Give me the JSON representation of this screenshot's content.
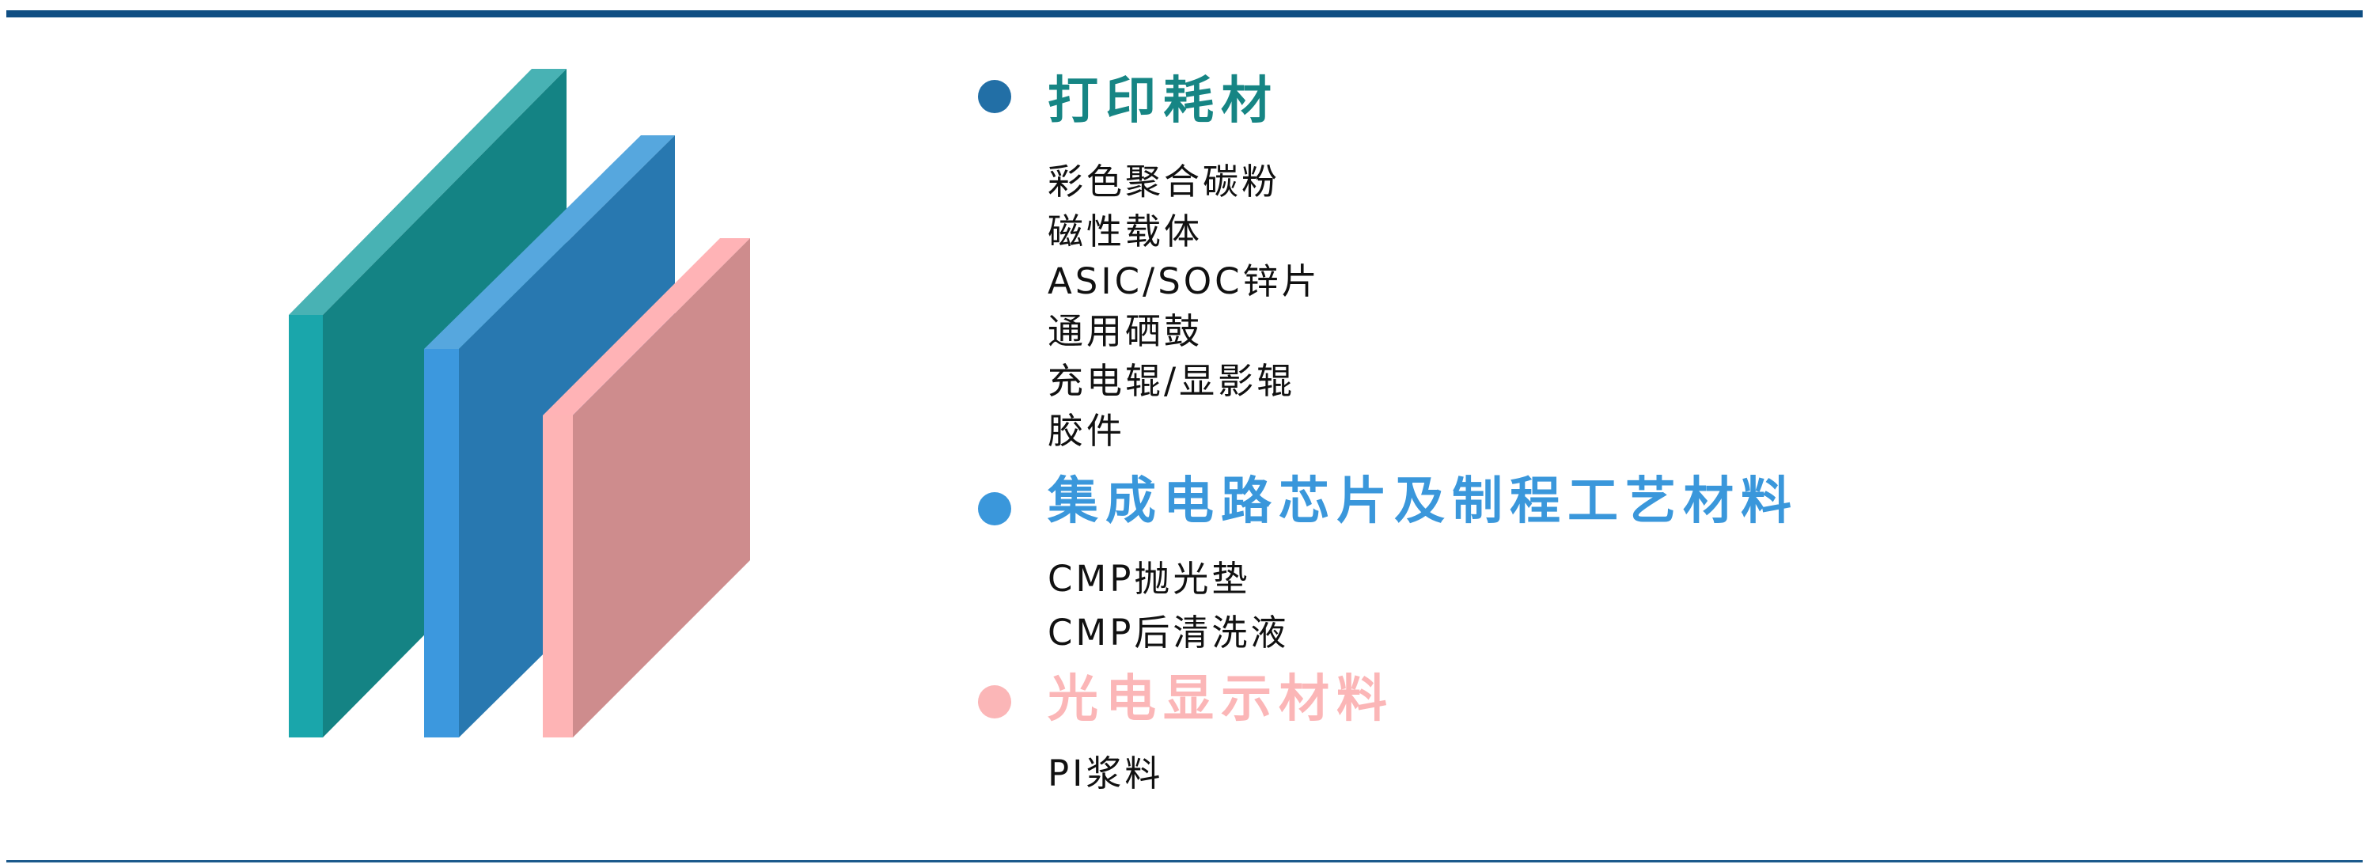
{
  "colors": {
    "rule": "#0f4e83",
    "teal_front": "#148384",
    "teal_top": "#48b2b4",
    "teal_side": "#1aa6ab",
    "blue_front": "#2878b0",
    "blue_top": "#56a7de",
    "blue_side": "#3c98de",
    "pink_front": "#ce8c8d",
    "pink_top": "#ffb3b6",
    "pink_side": "#feb4b5",
    "text": "#111111"
  },
  "sections": [
    {
      "title": "打印耗材",
      "color": "#168584",
      "bullet_color": "#226fa6",
      "items": [
        "彩色聚合碳粉",
        "磁性载体",
        "ASIC/SOC锌片",
        "通用硒鼓",
        "充电辊/显影辊",
        "胶件"
      ]
    },
    {
      "title": "集成电路芯片及制程工艺材料",
      "color": "#3a97db",
      "bullet_color": "#3a97db",
      "items": [
        "CMP抛光垫",
        "CMP后清洗液"
      ]
    },
    {
      "title": "光电显示材料",
      "color": "#fbb6b7",
      "bullet_color": "#fbb6b7",
      "items": [
        "PI浆料"
      ]
    }
  ]
}
